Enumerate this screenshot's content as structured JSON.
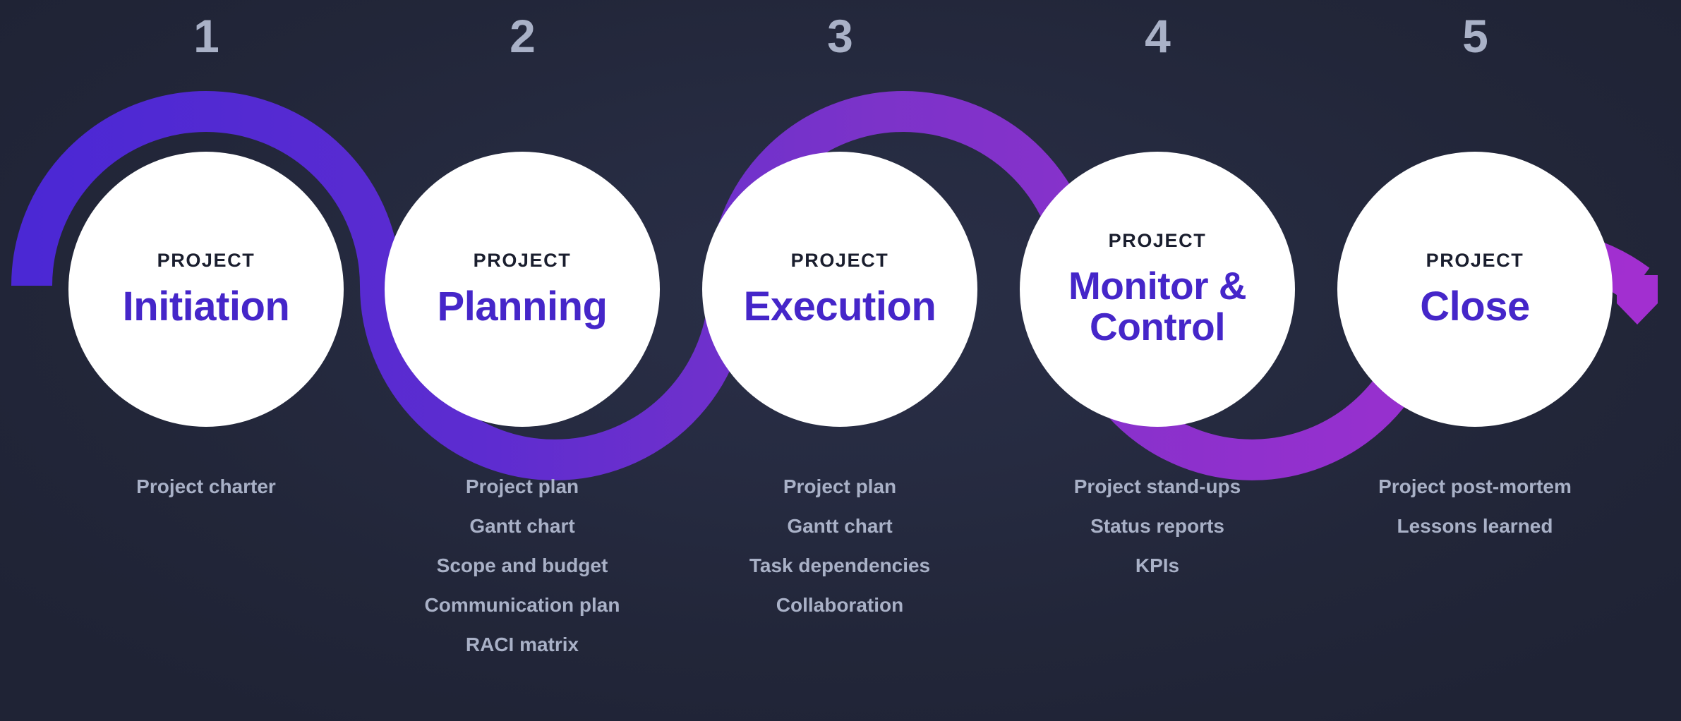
{
  "theme": {
    "background": "#222639",
    "circle_fill": "#ffffff",
    "eyebrow_color": "#1a1e2e",
    "title_color": "#4526c9",
    "number_color": "#a9b1c7",
    "list_color": "#a9b1c7",
    "ribbon_gradient_start": "#4b28d4",
    "ribbon_gradient_mid": "#7b33c9",
    "ribbon_gradient_end": "#a22fd0"
  },
  "phases": [
    {
      "number": "1",
      "eyebrow": "PROJECT",
      "title": "Initiation",
      "deliverables": [
        "Project charter"
      ]
    },
    {
      "number": "2",
      "eyebrow": "PROJECT",
      "title": "Planning",
      "deliverables": [
        "Project plan",
        "Gantt chart",
        "Scope and budget",
        "Communication plan",
        "RACI matrix"
      ]
    },
    {
      "number": "3",
      "eyebrow": "PROJECT",
      "title": "Execution",
      "deliverables": [
        "Project plan",
        "Gantt chart",
        "Task dependencies",
        "Collaboration"
      ]
    },
    {
      "number": "4",
      "eyebrow": "PROJECT",
      "title": "Monitor &\nControl",
      "deliverables": [
        "Project stand-ups",
        "Status reports",
        "KPIs"
      ]
    },
    {
      "number": "5",
      "eyebrow": "PROJECT",
      "title": "Close",
      "deliverables": [
        "Project post-mortem",
        "Lessons learned"
      ]
    }
  ]
}
